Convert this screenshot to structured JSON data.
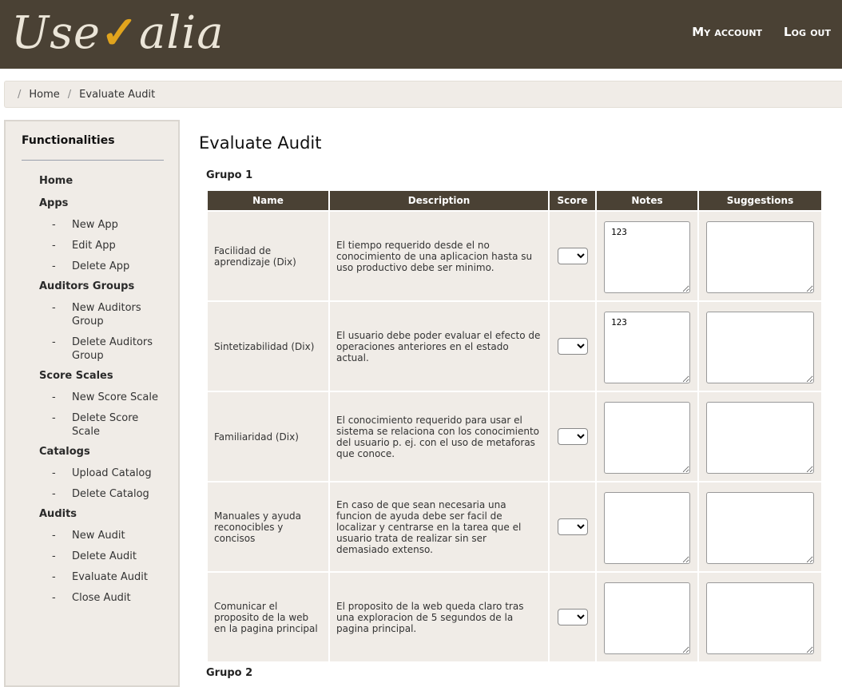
{
  "header": {
    "logo_text_a": "Use",
    "logo_tick": "✓",
    "logo_text_b": "alia",
    "nav": {
      "my_account": "My account",
      "log_out": "Log out"
    }
  },
  "breadcrumb": {
    "sep": "/",
    "home": "Home",
    "current": "Evaluate Audit"
  },
  "sidebar": {
    "title": "Functionalities",
    "home": "Home",
    "sections": [
      {
        "label": "Apps",
        "items": [
          "New App",
          "Edit App",
          "Delete App"
        ]
      },
      {
        "label": "Auditors Groups",
        "items": [
          "New Auditors Group",
          "Delete Auditors Group"
        ]
      },
      {
        "label": "Score Scales",
        "items": [
          "New Score Scale",
          "Delete Score Scale"
        ]
      },
      {
        "label": "Catalogs",
        "items": [
          "Upload Catalog",
          "Delete Catalog"
        ]
      },
      {
        "label": "Audits",
        "items": [
          "New Audit",
          "Delete Audit",
          "Evaluate Audit",
          "Close Audit"
        ]
      }
    ]
  },
  "main": {
    "title": "Evaluate Audit",
    "group1": "Grupo 1",
    "group2": "Grupo 2",
    "columns": {
      "name": "Name",
      "description": "Description",
      "score": "Score",
      "notes": "Notes",
      "suggestions": "Suggestions"
    },
    "rows": [
      {
        "name": "Facilidad de aprendizaje (Dix)",
        "description": "El tiempo requerido desde el no conocimiento de una aplicacion hasta su uso productivo debe ser minimo.",
        "notes": "123",
        "suggestions": ""
      },
      {
        "name": "Sintetizabilidad (Dix)",
        "description": "El usuario debe poder evaluar el efecto de operaciones anteriores en el estado actual.",
        "notes": "123",
        "suggestions": ""
      },
      {
        "name": "Familiaridad (Dix)",
        "description": "El conocimiento requerido para usar el sistema se relaciona con los conocimiento del usuario p. ej. con el uso de metaforas que conoce.",
        "notes": "",
        "suggestions": ""
      },
      {
        "name": "Manuales y ayuda reconocibles y concisos",
        "description": "En caso de que sean necesaria una funcion de ayuda debe ser facil de localizar y centrarse en la tarea que el usuario trata de realizar sin ser demasiado extenso.",
        "notes": "",
        "suggestions": ""
      },
      {
        "name": "Comunicar el proposito de la web en la pagina principal",
        "description": "El proposito de la web queda claro tras una exploracion de 5 segundos de la pagina principal.",
        "notes": "",
        "suggestions": ""
      }
    ]
  }
}
